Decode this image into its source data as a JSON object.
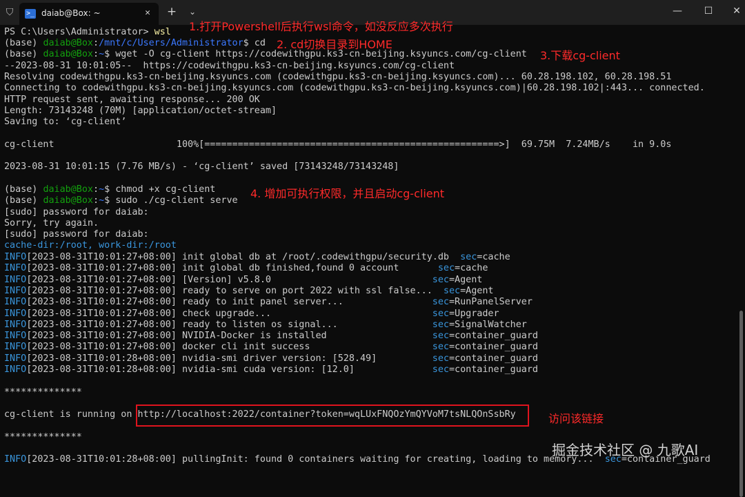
{
  "window": {
    "tab_title": "daiab@Box: ~",
    "tab_icon": "terminal-icon",
    "tab_icon_glyph": ">_",
    "close_tab_glyph": "✕",
    "new_tab_glyph": "+",
    "dropdown_glyph": "⌄",
    "minimize_glyph": "—",
    "maximize_glyph": "☐",
    "close_glyph": "✕",
    "shield_glyph": "⛉"
  },
  "colors": {
    "background": "#0c0c0c",
    "prompt_green": "#13a10e",
    "path_blue": "#3b78ff",
    "info_cyan": "#3a96dd",
    "annotation_red": "#ff2a2a"
  },
  "terminal": {
    "l01_text": "PS C:\\Users\\Administrator> ",
    "l01_cmd": "wsl",
    "base": "(base) ",
    "user": "daiab@Box",
    "colon": ":",
    "path_mnt": "/mnt/c/Users/Administrator",
    "path_home": "~",
    "dollar": "$ ",
    "cmd_cd": "cd",
    "cmd_wget": "wget -O cg-client https://codewithgpu.ks3-cn-beijing.ksyuncs.com/cg-client",
    "l04": "--2023-08-31 10:01:05--  https://codewithgpu.ks3-cn-beijing.ksyuncs.com/cg-client",
    "l05": "Resolving codewithgpu.ks3-cn-beijing.ksyuncs.com (codewithgpu.ks3-cn-beijing.ksyuncs.com)... 60.28.198.102, 60.28.198.51",
    "l06": "Connecting to codewithgpu.ks3-cn-beijing.ksyuncs.com (codewithgpu.ks3-cn-beijing.ksyuncs.com)|60.28.198.102|:443... connected.",
    "l07": "HTTP request sent, awaiting response... 200 OK",
    "l08": "Length: 73143248 (70M) [application/octet-stream]",
    "l09": "Saving to: ‘cg-client’",
    "l11": "cg-client                      100%[=====================================================>]  69.75M  7.24MB/s    in 9.0s",
    "l13": "2023-08-31 10:01:15 (7.76 MB/s) - ‘cg-client’ saved [73143248/73143248]",
    "cmd_chmod": "chmod +x cg-client",
    "cmd_sudo": "sudo ./cg-client serve",
    "l17": "[sudo] password for daiab:",
    "l18": "Sorry, try again.",
    "l19": "[sudo] password for daiab:",
    "l20": "cache-dir:/root, work-dir:/root",
    "info": "INFO",
    "sec": "sec",
    "logs": [
      {
        "ts": "[2023-08-31T10:01:27+08:00] ",
        "msg": "init global db at /root/.codewithgpu/security.db  ",
        "sec": "=cache"
      },
      {
        "ts": "[2023-08-31T10:01:27+08:00] ",
        "msg": "init global db finished,found 0 account       ",
        "sec": "=cache"
      },
      {
        "ts": "[2023-08-31T10:01:27+08:00] ",
        "msg": "[Version] v5.8.0                             ",
        "sec": "=Agent"
      },
      {
        "ts": "[2023-08-31T10:01:27+08:00] ",
        "msg": "ready to serve on port 2022 with ssl false...  ",
        "sec": "=Agent"
      },
      {
        "ts": "[2023-08-31T10:01:27+08:00] ",
        "msg": "ready to init panel server...                ",
        "sec": "=RunPanelServer"
      },
      {
        "ts": "[2023-08-31T10:01:27+08:00] ",
        "msg": "check upgrade...                             ",
        "sec": "=Upgrader"
      },
      {
        "ts": "[2023-08-31T10:01:27+08:00] ",
        "msg": "ready to listen os signal...                 ",
        "sec": "=SignalWatcher"
      },
      {
        "ts": "[2023-08-31T10:01:27+08:00] ",
        "msg": "NVIDIA-Docker is installed                   ",
        "sec": "=container_guard"
      },
      {
        "ts": "[2023-08-31T10:01:27+08:00] ",
        "msg": "docker cli init success                      ",
        "sec": "=container_guard"
      },
      {
        "ts": "[2023-08-31T10:01:28+08:00] ",
        "msg": "nvidia-smi driver version: [528.49]          ",
        "sec": "=container_guard"
      },
      {
        "ts": "[2023-08-31T10:01:28+08:00] ",
        "msg": "nvidia-smi cuda version: [12.0]              ",
        "sec": "=container_guard"
      }
    ],
    "stars": "**************",
    "running_prefix": "cg-client is running on ",
    "running_url": "http://localhost:2022/container?token=wqLUxFNQOzYmQYVoM7tsNLQOnSsbRy",
    "last_ts": "[2023-08-31T10:01:28+08:00] ",
    "last_msg": "pullingInit: found 0 containers waiting for creating, loading to memory...  ",
    "last_sec": "=container_guard"
  },
  "annotations": {
    "step1": "1.打开Powershell后执行wsl命令，如没反应多次执行",
    "step2": "2. cd切换目录到HOME",
    "step3": "3.下载cg-client",
    "step4": "4. 增加可执行权限，并且启动cg-client",
    "visit": "访问该链接"
  },
  "watermark": "掘金技术社区 @ 九歌AI"
}
